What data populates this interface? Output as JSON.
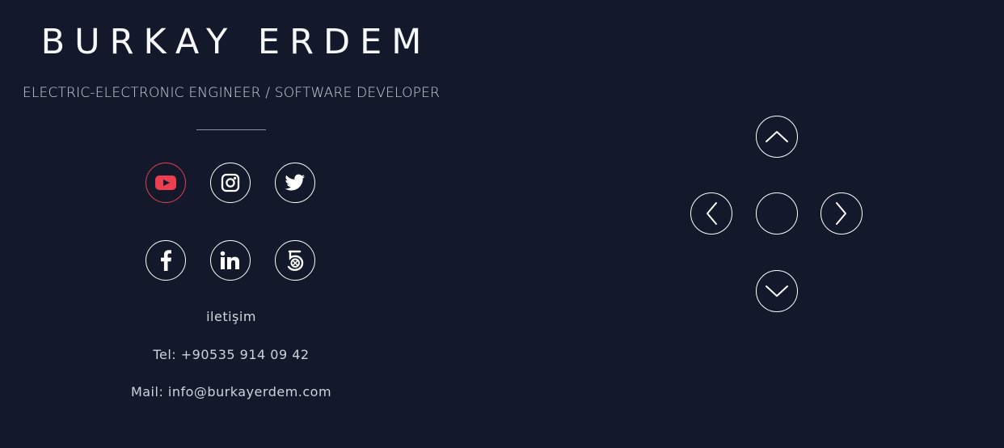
{
  "header": {
    "name": "BURKAY ERDEM",
    "subtitle": "ELECTRIC-ELECTRONIC ENGINEER / SOFTWARE DEVELOPER"
  },
  "social": {
    "items": [
      {
        "icon": "youtube-icon",
        "active_color": "#ea3f51"
      },
      {
        "icon": "instagram-icon"
      },
      {
        "icon": "twitter-icon"
      },
      {
        "icon": "facebook-icon"
      },
      {
        "icon": "linkedin-icon"
      },
      {
        "icon": "500px-icon"
      }
    ]
  },
  "contact": {
    "title": "iletişim",
    "phone": "Tel: +90535 914 09 42",
    "mail": "Mail: info@burkayerdem.com"
  },
  "navigation": {
    "controls": [
      {
        "icon": "chevron-up-icon"
      },
      {
        "icon": "chevron-left-icon"
      },
      {
        "icon": "center-icon"
      },
      {
        "icon": "chevron-right-icon"
      },
      {
        "icon": "chevron-down-icon"
      }
    ]
  },
  "colors": {
    "background": "#13182b",
    "text": "#ffffff",
    "muted_text": "#cfd2db",
    "accent": "#ea3f51"
  }
}
